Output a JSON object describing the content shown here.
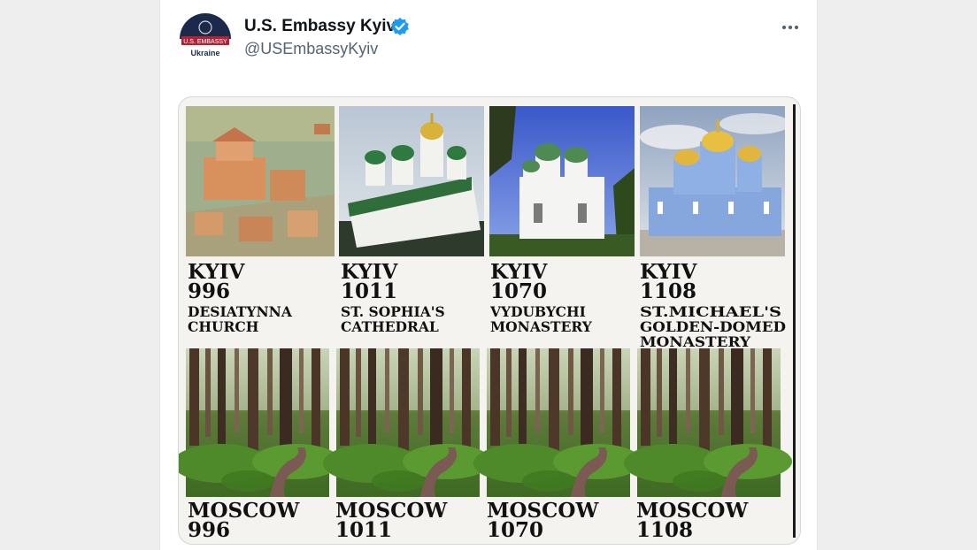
{
  "tweet": {
    "author_name": "U.S. Embassy Kyiv",
    "handle": "@USEmbassyKyiv",
    "avatar": {
      "badge_text": "U.S. EMBASSY",
      "country": "Ukraine"
    },
    "more_icon": "more-horizontal-icon",
    "verified_icon": "verified-badge-icon",
    "colors": {
      "verified": "#1d9bf0",
      "text": "#0f1419",
      "muted": "#536471",
      "avatar_navy": "#1b2a4a",
      "avatar_red": "#b22234"
    }
  },
  "image": {
    "kyiv": [
      {
        "city": "KYIV",
        "year": "996",
        "name_lines": [
          "DESIATYNNA",
          "CHURCH"
        ]
      },
      {
        "city": "KYIV",
        "year": "1011",
        "name_lines": [
          "ST. SOPHIA'S",
          "CATHEDRAL"
        ]
      },
      {
        "city": "KYIV",
        "year": "1070",
        "name_lines": [
          "VYDUBYCHI",
          "MONASTERY"
        ]
      },
      {
        "city": "KYIV",
        "year": "1108",
        "name_lines": [
          "ST.MICHAEL'S",
          "GOLDEN-DOMED",
          "MONASTERY"
        ]
      }
    ],
    "moscow": [
      {
        "city": "MOSCOW",
        "year": "996"
      },
      {
        "city": "MOSCOW",
        "year": "1011"
      },
      {
        "city": "MOSCOW",
        "year": "1070"
      },
      {
        "city": "MOSCOW",
        "year": "1108"
      }
    ]
  }
}
